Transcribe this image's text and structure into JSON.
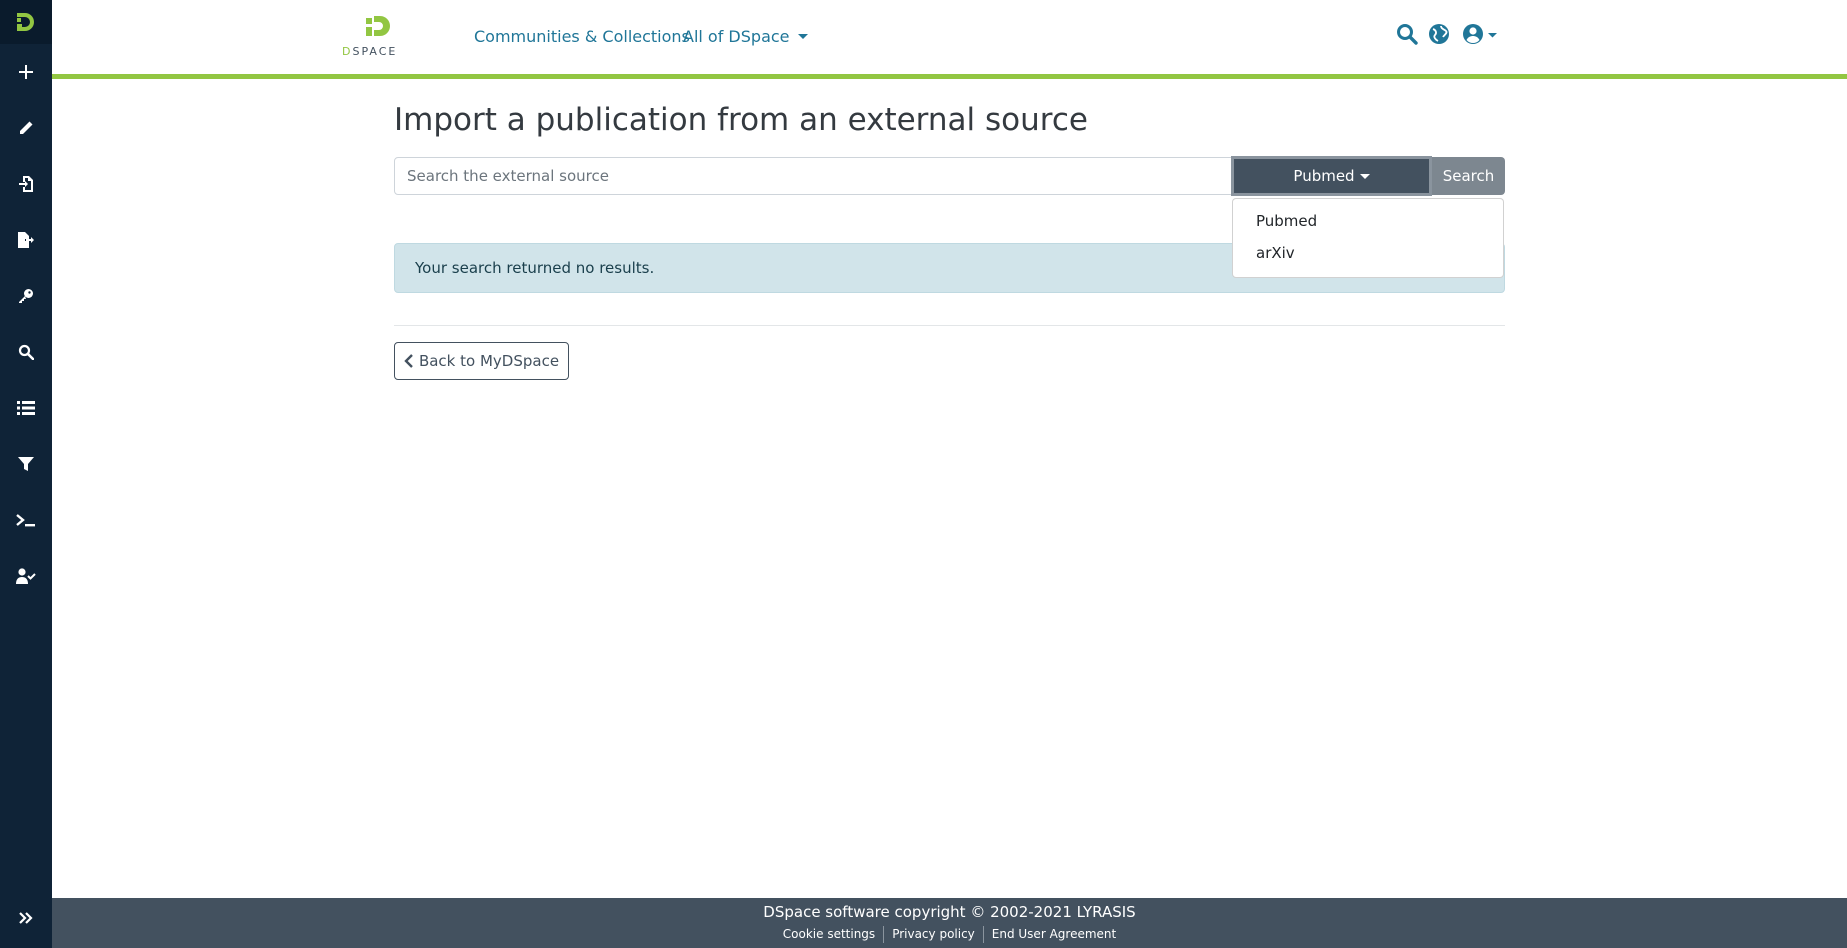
{
  "header": {
    "brand_word": "SPACE",
    "brand_initial": "D",
    "nav_communities": "Communities & Collections",
    "nav_all": "All of DSpace"
  },
  "main": {
    "title": "Import a publication from an external source",
    "search_placeholder": "Search the external source",
    "source_selected": "Pubmed",
    "search_button": "Search",
    "alert_text": "Your search returned no results.",
    "back_button": "Back to MyDSpace",
    "dropdown_options": [
      "Pubmed",
      "arXiv"
    ]
  },
  "footer": {
    "copyright": "DSpace software copyright © 2002-2021 LYRASIS",
    "links": [
      "Cookie settings",
      "Privacy policy",
      "End User Agreement"
    ]
  },
  "colors": {
    "sidebar_bg": "#0f2337",
    "accent_green": "#92c642",
    "link_blue": "#207698",
    "dark_slate": "#43515f",
    "alert_bg": "#d1e4ea"
  },
  "icons": {
    "sidebar": [
      "dspace-logo-icon",
      "plus-icon",
      "pencil-icon",
      "file-import-icon",
      "file-export-icon",
      "key-icon",
      "search-icon",
      "list-icon",
      "filter-icon",
      "terminal-icon",
      "user-check-icon",
      "expand-icon"
    ],
    "header": [
      "search-icon",
      "globe-icon",
      "user-circle-icon",
      "chevron-left-icon"
    ]
  }
}
